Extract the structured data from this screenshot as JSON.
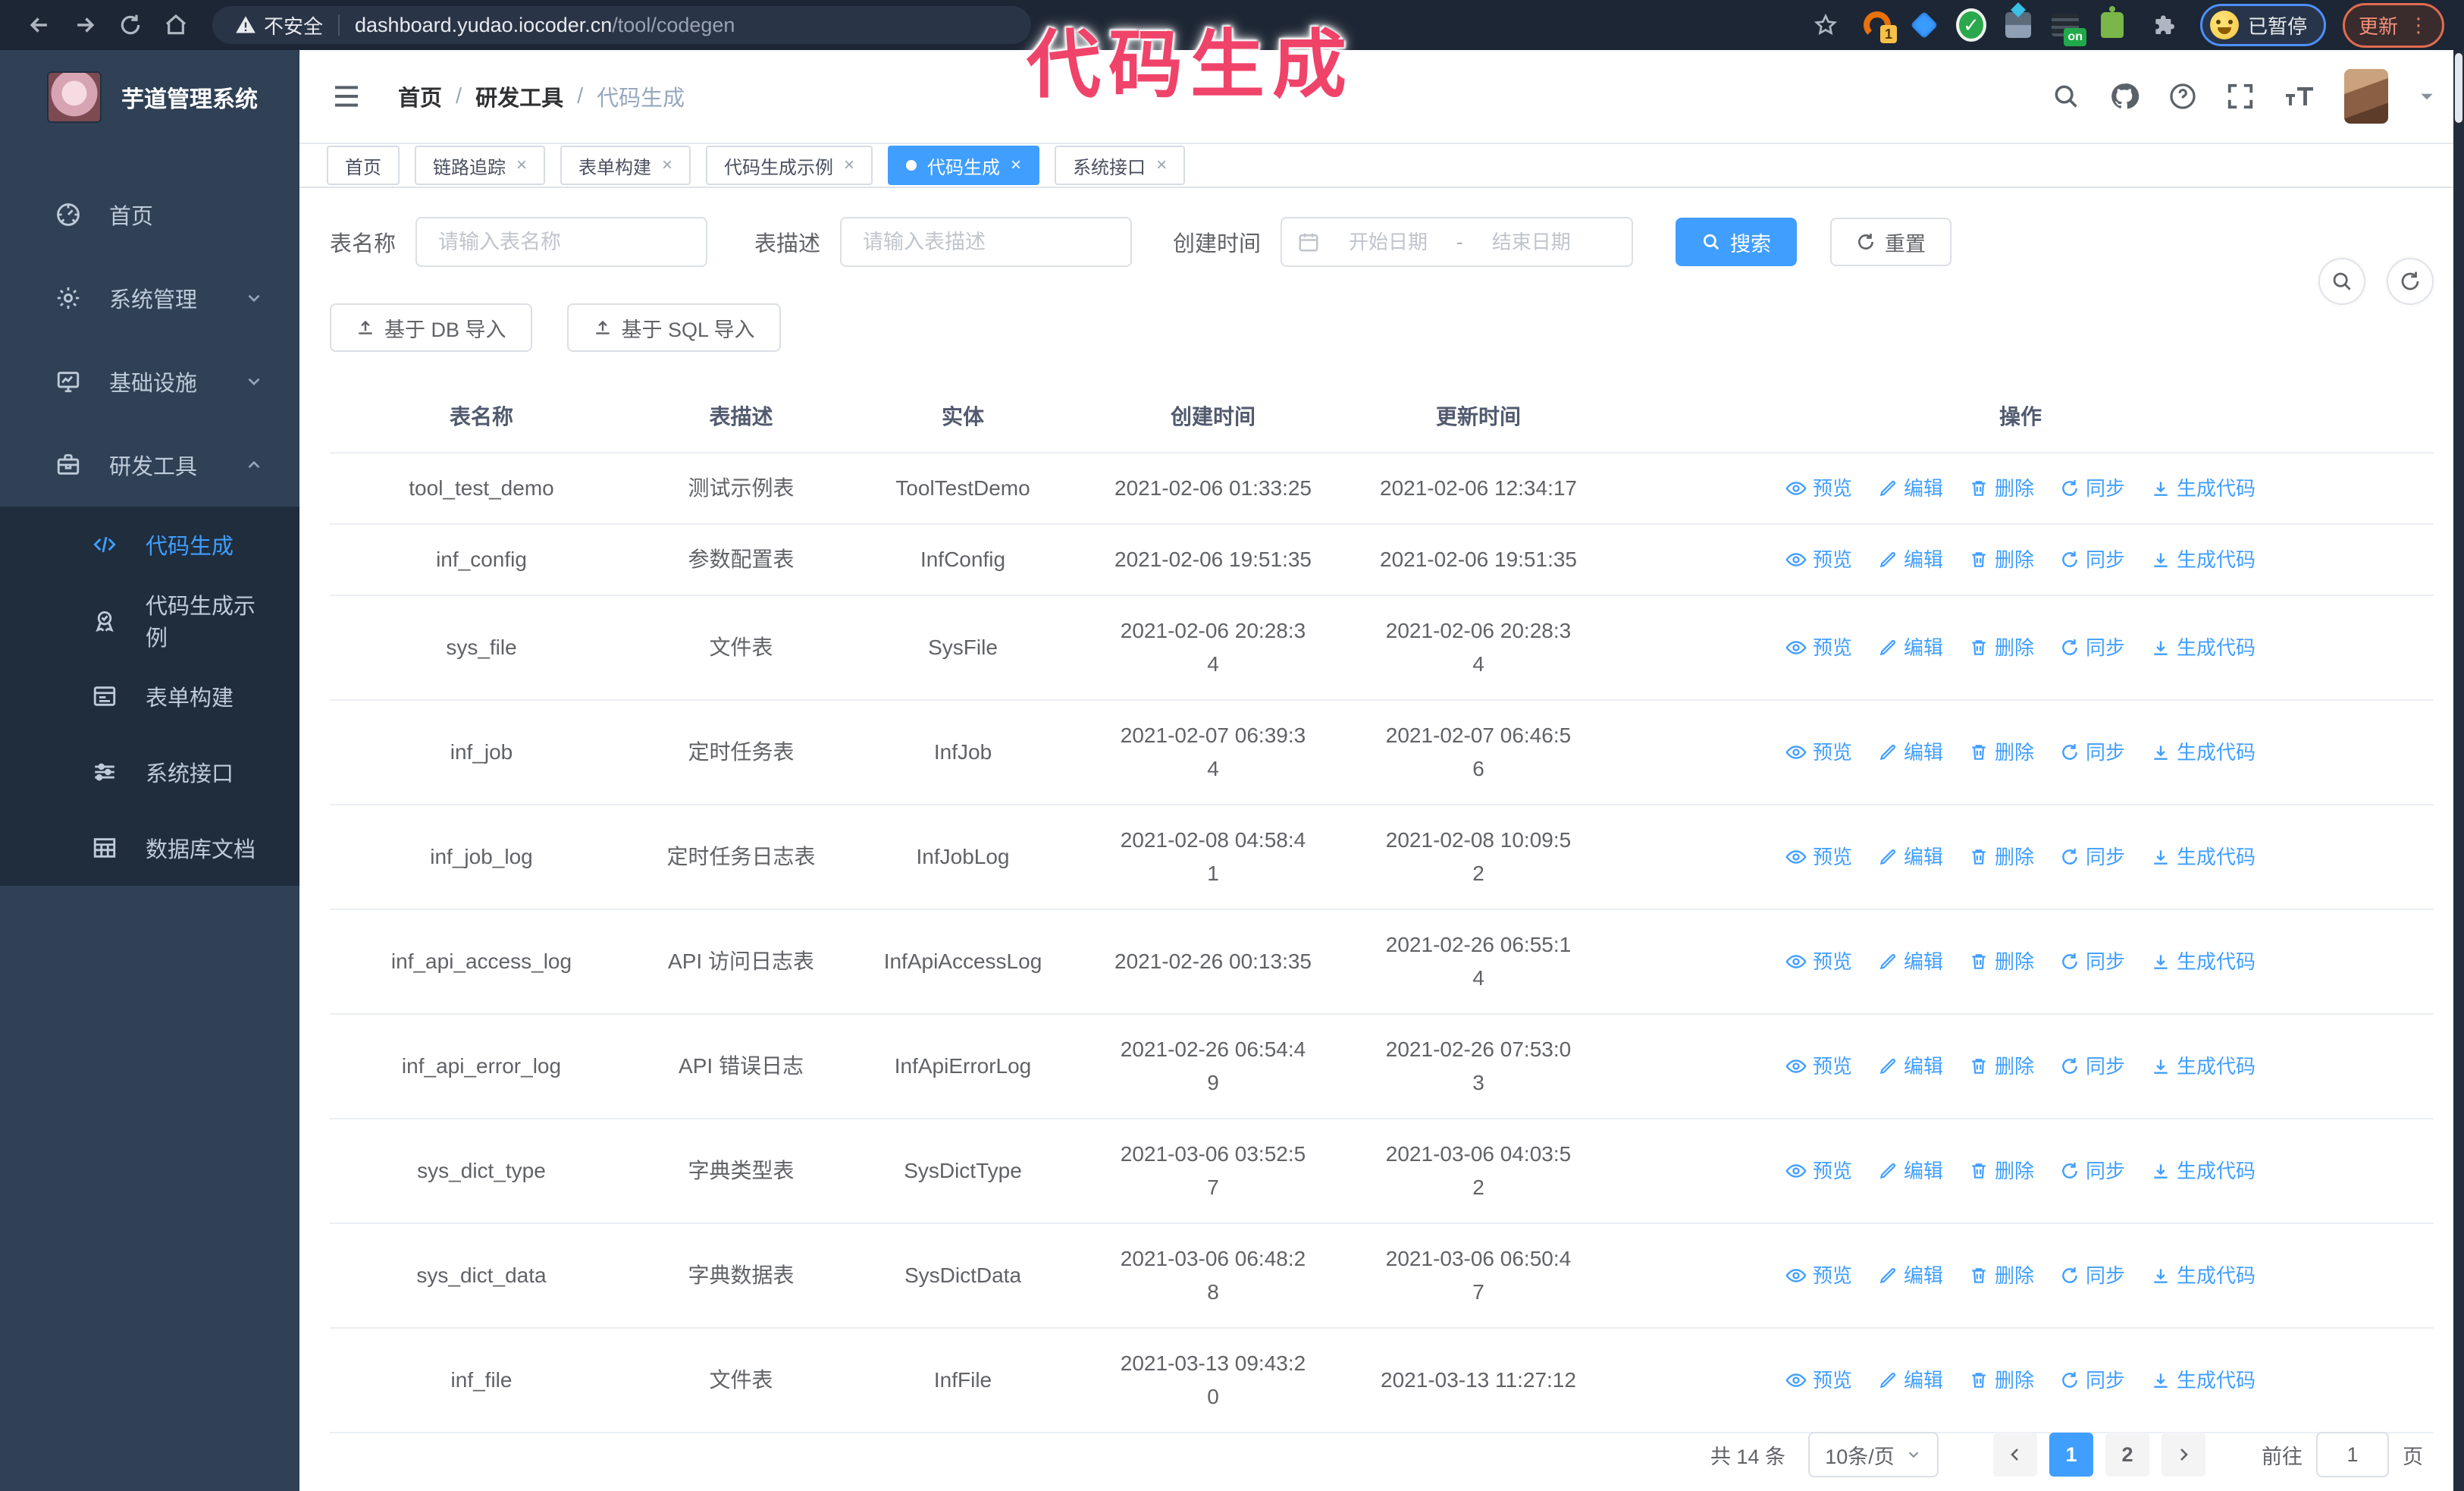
{
  "browser": {
    "security_label": "不安全",
    "url_host": "dashboard.yudao.iocoder.cn",
    "url_path": "/tool/codegen",
    "extension_badge": "1",
    "extension_on_badge": "on",
    "paused_badge": "已暂停",
    "update_button": "更新"
  },
  "annotation": {
    "text": "代码生成",
    "color": "#f0436a"
  },
  "sidebar": {
    "app_title": "芋道管理系统",
    "items": [
      {
        "label": "首页",
        "icon": "dashboard-icon",
        "chevron": ""
      },
      {
        "label": "系统管理",
        "icon": "gear-icon",
        "chevron": "down"
      },
      {
        "label": "基础设施",
        "icon": "monitor-icon",
        "chevron": "down"
      },
      {
        "label": "研发工具",
        "icon": "toolbox-icon",
        "chevron": "up"
      }
    ],
    "submenu": [
      {
        "label": "代码生成",
        "icon": "code-icon",
        "active": true
      },
      {
        "label": "代码生成示例",
        "icon": "medal-icon",
        "active": false
      },
      {
        "label": "表单构建",
        "icon": "form-icon",
        "active": false
      },
      {
        "label": "系统接口",
        "icon": "sliders-icon",
        "active": false
      },
      {
        "label": "数据库文档",
        "icon": "dbtable-icon",
        "active": false
      }
    ]
  },
  "header": {
    "breadcrumb": [
      "首页",
      "研发工具",
      "代码生成"
    ],
    "separator": "/"
  },
  "tabs": [
    {
      "label": "首页",
      "closable": false,
      "active": false
    },
    {
      "label": "链路追踪",
      "closable": true,
      "active": false
    },
    {
      "label": "表单构建",
      "closable": true,
      "active": false
    },
    {
      "label": "代码生成示例",
      "closable": true,
      "active": false
    },
    {
      "label": "代码生成",
      "closable": true,
      "active": true
    },
    {
      "label": "系统接口",
      "closable": true,
      "active": false
    }
  ],
  "filters": {
    "table_name_label": "表名称",
    "table_name_placeholder": "请输入表名称",
    "table_desc_label": "表描述",
    "table_desc_placeholder": "请输入表描述",
    "create_time_label": "创建时间",
    "start_placeholder": "开始日期",
    "range_separator": "-",
    "end_placeholder": "结束日期",
    "search_button": "搜索",
    "reset_button": "重置"
  },
  "toolbar": {
    "import_db": "基于 DB 导入",
    "import_sql": "基于 SQL 导入"
  },
  "table": {
    "columns": [
      "表名称",
      "表描述",
      "实体",
      "创建时间",
      "更新时间",
      "操作"
    ],
    "actions": [
      {
        "label": "预览",
        "icon": "eye-icon"
      },
      {
        "label": "编辑",
        "icon": "edit-icon"
      },
      {
        "label": "删除",
        "icon": "delete-icon"
      },
      {
        "label": "同步",
        "icon": "sync-icon"
      },
      {
        "label": "生成代码",
        "icon": "download-icon"
      }
    ],
    "rows": [
      {
        "name": "tool_test_demo",
        "desc": "测试示例表",
        "entity": "ToolTestDemo",
        "created": "2021-02-06 01:33:25",
        "updated": "2021-02-06 12:34:17"
      },
      {
        "name": "inf_config",
        "desc": "参数配置表",
        "entity": "InfConfig",
        "created": "2021-02-06 19:51:35",
        "updated": "2021-02-06 19:51:35"
      },
      {
        "name": "sys_file",
        "desc": "文件表",
        "entity": "SysFile",
        "created": "2021-02-06 20:28:3\n4",
        "updated": "2021-02-06 20:28:3\n4"
      },
      {
        "name": "inf_job",
        "desc": "定时任务表",
        "entity": "InfJob",
        "created": "2021-02-07 06:39:3\n4",
        "updated": "2021-02-07 06:46:5\n6"
      },
      {
        "name": "inf_job_log",
        "desc": "定时任务日志表",
        "entity": "InfJobLog",
        "created": "2021-02-08 04:58:4\n1",
        "updated": "2021-02-08 10:09:5\n2"
      },
      {
        "name": "inf_api_access_log",
        "desc": "API 访问日志表",
        "entity": "InfApiAccessLog",
        "created": "2021-02-26 00:13:35",
        "updated": "2021-02-26 06:55:1\n4"
      },
      {
        "name": "inf_api_error_log",
        "desc": "API 错误日志",
        "entity": "InfApiErrorLog",
        "created": "2021-02-26 06:54:4\n9",
        "updated": "2021-02-26 07:53:0\n3"
      },
      {
        "name": "sys_dict_type",
        "desc": "字典类型表",
        "entity": "SysDictType",
        "created": "2021-03-06 03:52:5\n7",
        "updated": "2021-03-06 04:03:5\n2"
      },
      {
        "name": "sys_dict_data",
        "desc": "字典数据表",
        "entity": "SysDictData",
        "created": "2021-03-06 06:48:2\n8",
        "updated": "2021-03-06 06:50:4\n7"
      },
      {
        "name": "inf_file",
        "desc": "文件表",
        "entity": "InfFile",
        "created": "2021-03-13 09:43:2\n0",
        "updated": "2021-03-13 11:27:12"
      }
    ]
  },
  "pagination": {
    "total": "共 14 条",
    "page_size": "10条/页",
    "pages": [
      "1",
      "2"
    ],
    "active_page": "1",
    "goto_label": "前往",
    "goto_value": "1",
    "page_label": "页"
  }
}
